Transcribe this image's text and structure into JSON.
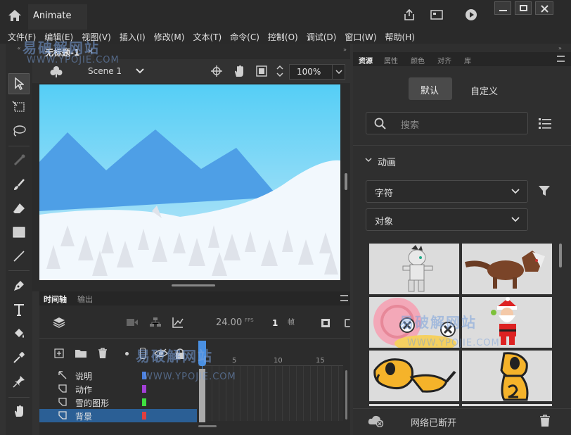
{
  "app": {
    "title": "Animate"
  },
  "menu": [
    "文件(F)",
    "编辑(E)",
    "视图(V)",
    "插入(I)",
    "修改(M)",
    "文本(T)",
    "命令(C)",
    "控制(O)",
    "调试(D)",
    "窗口(W)",
    "帮助(H)"
  ],
  "document": {
    "tab_label": "无标题-1",
    "scene": "Scene 1",
    "zoom": "100%"
  },
  "timeline": {
    "tabs": [
      "时间轴",
      "输出"
    ],
    "fps": "24.00",
    "fps_unit": "FPS",
    "frame": "1",
    "frame_unit": "帧",
    "ruler": [
      "5",
      "10",
      "15"
    ],
    "layers": [
      {
        "name": "说明",
        "color": "#4a7fe0"
      },
      {
        "name": "动作",
        "color": "#a33fd6"
      },
      {
        "name": "雪的图形",
        "color": "#3fe03f"
      },
      {
        "name": "背景",
        "color": "#e03f3f"
      }
    ]
  },
  "assets": {
    "tabs": [
      "资源",
      "属性",
      "颜色",
      "对齐",
      "库"
    ],
    "toggle": [
      "默认",
      "自定义"
    ],
    "search_placeholder": "搜索",
    "section": "动画",
    "dropdown1": "字符",
    "dropdown2": "对象",
    "status": "网络已断开"
  },
  "watermark": {
    "text": "易破解网站",
    "url": "WWW.YPOJIE.COM"
  },
  "colors": {
    "sky_top": "#55cef6",
    "sky_bottom": "#b8e4f8",
    "mountain": "#4e9fe6",
    "snow": "#f2f8fd",
    "tree": "#dfe3ea",
    "accent": "#2d7dd2"
  }
}
